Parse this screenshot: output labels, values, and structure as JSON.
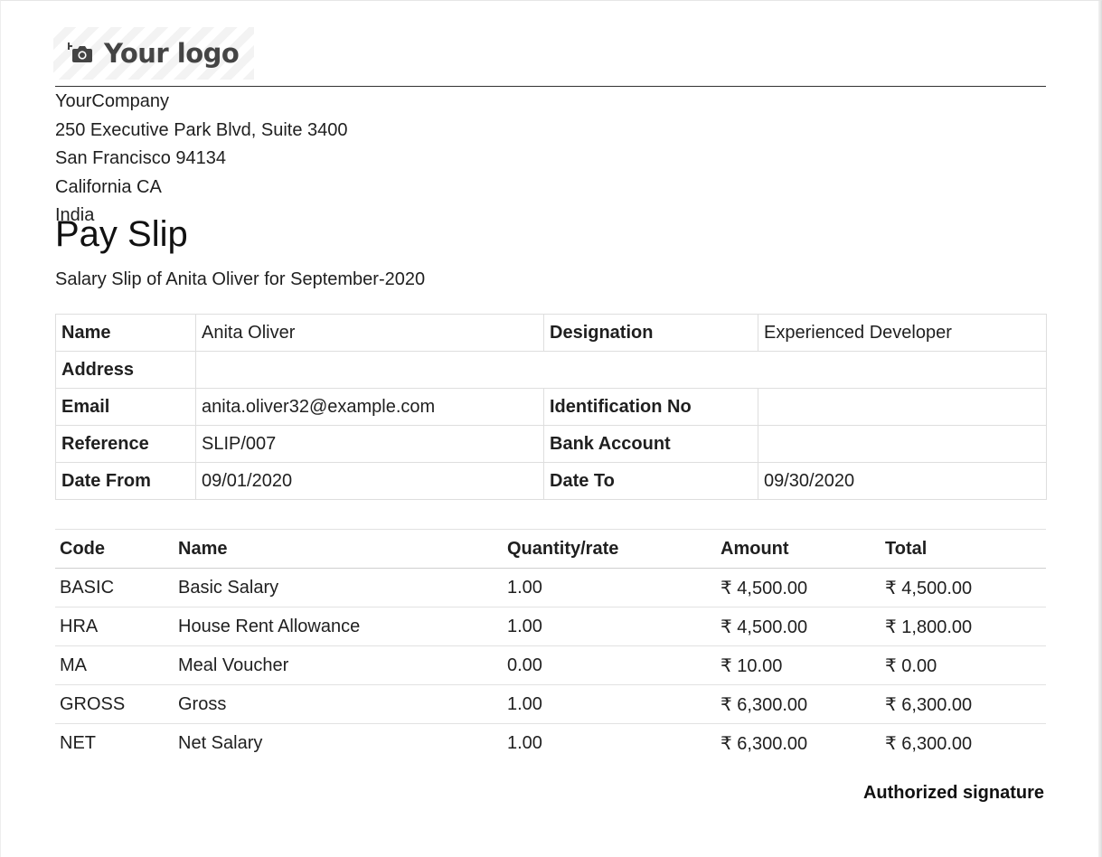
{
  "logo": {
    "text": "Your logo",
    "icon": "camera-add-icon"
  },
  "company": {
    "name": "YourCompany",
    "street": "250 Executive Park Blvd, Suite 3400",
    "city_zip": "San Francisco 94134",
    "state": "California CA",
    "country": "India"
  },
  "document": {
    "title": "Pay Slip",
    "subtitle": "Salary Slip of Anita Oliver for September-2020"
  },
  "employee": {
    "name_label": "Name",
    "name_value": "Anita Oliver",
    "designation_label": "Designation",
    "designation_value": "Experienced Developer",
    "address_label": "Address",
    "address_value": "",
    "email_label": "Email",
    "email_value": "anita.oliver32@example.com",
    "identification_label": "Identification No",
    "identification_value": "",
    "reference_label": "Reference",
    "reference_value": "SLIP/007",
    "bank_label": "Bank Account",
    "bank_value": "",
    "date_from_label": "Date From",
    "date_from_value": "09/01/2020",
    "date_to_label": "Date To",
    "date_to_value": "09/30/2020"
  },
  "lines": {
    "headers": [
      "Code",
      "Name",
      "Quantity/rate",
      "Amount",
      "Total"
    ],
    "rows": [
      {
        "code": "BASIC",
        "name": "Basic Salary",
        "qty": "1.00",
        "amount": "₹ 4,500.00",
        "total": "₹ 4,500.00"
      },
      {
        "code": "HRA",
        "name": "House Rent Allowance",
        "qty": "1.00",
        "amount": "₹ 4,500.00",
        "total": "₹ 1,800.00"
      },
      {
        "code": "MA",
        "name": "Meal Voucher",
        "qty": "0.00",
        "amount": "₹ 10.00",
        "total": "₹ 0.00"
      },
      {
        "code": "GROSS",
        "name": "Gross",
        "qty": "1.00",
        "amount": "₹ 6,300.00",
        "total": "₹ 6,300.00"
      },
      {
        "code": "NET",
        "name": "Net Salary",
        "qty": "1.00",
        "amount": "₹ 6,300.00",
        "total": "₹ 6,300.00"
      }
    ]
  },
  "footer": {
    "signature": "Authorized signature"
  }
}
